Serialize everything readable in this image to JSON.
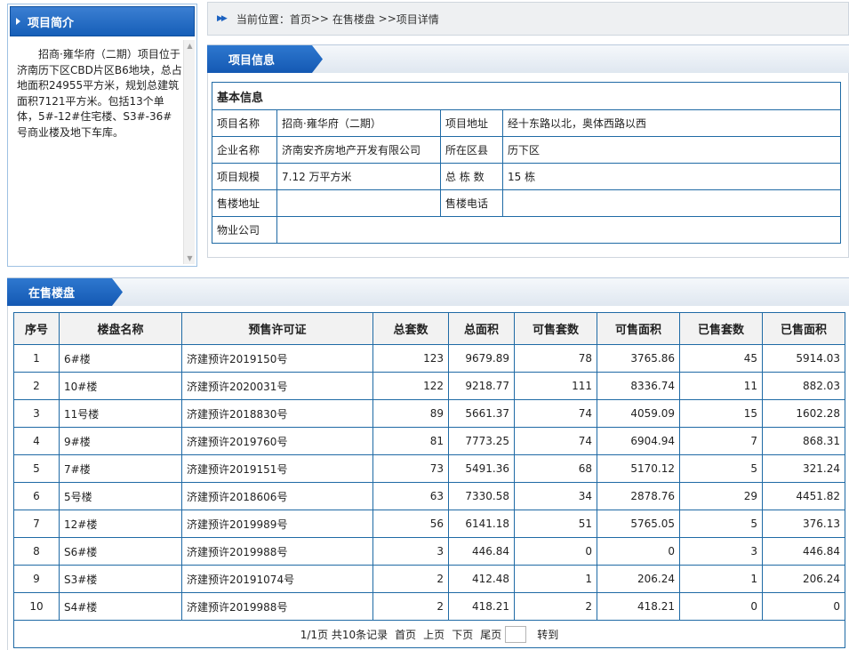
{
  "intro": {
    "title": "项目简介",
    "text": "招商·雍华府（二期）项目位于济南历下区CBD片区B6地块，总占地面积24955平方米，规划总建筑面积7121平方米。包括13个单体，5#-12#住宅楼、S3#-36#号商业楼及地下车库。"
  },
  "breadcrumb": {
    "prefix": "当前位置：",
    "home": "首页",
    "sep1": ">>",
    "section": "在售楼盘",
    "sep2": ">>",
    "current": "项目详情"
  },
  "info": {
    "tab": "项目信息",
    "basic_title": "基本信息",
    "rows": [
      {
        "l1": "项目名称",
        "v1": "招商·雍华府（二期）",
        "l2": "项目地址",
        "v2": "经十东路以北，奥体西路以西"
      },
      {
        "l1": "企业名称",
        "v1": "济南安齐房地产开发有限公司",
        "l2": "所在区县",
        "v2": "历下区"
      },
      {
        "l1": "项目规模",
        "v1": "7.12 万平方米",
        "l2": "总 栋 数",
        "v2": "15 栋"
      },
      {
        "l1": "售楼地址",
        "v1": "",
        "l2": "售楼电话",
        "v2": ""
      }
    ],
    "property_label": "物业公司",
    "property_value": ""
  },
  "sale": {
    "tab": "在售楼盘",
    "headers": [
      "序号",
      "楼盘名称",
      "预售许可证",
      "总套数",
      "总面积",
      "可售套数",
      "可售面积",
      "已售套数",
      "已售面积"
    ],
    "rows": [
      [
        "1",
        "6#楼",
        "济建预许2019150号",
        "123",
        "9679.89",
        "78",
        "3765.86",
        "45",
        "5914.03"
      ],
      [
        "2",
        "10#楼",
        "济建预许2020031号",
        "122",
        "9218.77",
        "111",
        "8336.74",
        "11",
        "882.03"
      ],
      [
        "3",
        "11号楼",
        "济建预许2018830号",
        "89",
        "5661.37",
        "74",
        "4059.09",
        "15",
        "1602.28"
      ],
      [
        "4",
        "9#楼",
        "济建预许2019760号",
        "81",
        "7773.25",
        "74",
        "6904.94",
        "7",
        "868.31"
      ],
      [
        "5",
        "7#楼",
        "济建预许2019151号",
        "73",
        "5491.36",
        "68",
        "5170.12",
        "5",
        "321.24"
      ],
      [
        "6",
        "5号楼",
        "济建预许2018606号",
        "63",
        "7330.58",
        "34",
        "2878.76",
        "29",
        "4451.82"
      ],
      [
        "7",
        "12#楼",
        "济建预许2019989号",
        "56",
        "6141.18",
        "51",
        "5765.05",
        "5",
        "376.13"
      ],
      [
        "8",
        "S6#楼",
        "济建预许2019988号",
        "3",
        "446.84",
        "0",
        "0",
        "3",
        "446.84"
      ],
      [
        "9",
        "S3#楼",
        "济建预许20191074号",
        "2",
        "412.48",
        "1",
        "206.24",
        "1",
        "206.24"
      ],
      [
        "10",
        "S4#楼",
        "济建预许2019988号",
        "2",
        "418.21",
        "2",
        "418.21",
        "0",
        "0"
      ]
    ],
    "pager": {
      "summary": "1/1页 共10条记录",
      "first": "首页",
      "prev": "上页",
      "next": "下页",
      "last": "尾页",
      "goto": "转到"
    }
  }
}
